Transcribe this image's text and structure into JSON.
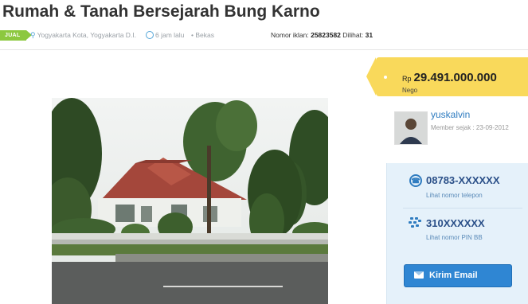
{
  "listing": {
    "title": "Rumah & Tanah Bersejarah Bung Karno",
    "badge": "JUAL",
    "location": "Yogyakarta Kota, Yogyakarta D.I.",
    "posted": "6 jam lalu",
    "condition": "• Bekas",
    "ad_number_label": "Nomor iklan:",
    "ad_number": "25823582",
    "views_label": "Dilihat:",
    "views": "31"
  },
  "price": {
    "currency": "Rp",
    "amount": "29.491.000.000",
    "nego": "Nego"
  },
  "seller": {
    "name": "yuskalvin",
    "member_since": "Member sejak : 23-09-2012"
  },
  "contact": {
    "phone": "08783-XXXXXX",
    "phone_link": "Lihat nomor telepon",
    "bb_pin": "310XXXXXX",
    "bb_link": "Lihat nomor PIN BB",
    "email_button": "Kirim Email"
  },
  "colors": {
    "badge": "#8cc83f",
    "price_tag": "#f9d95b",
    "link": "#2f7cc0",
    "contact_bg": "#e5f1fa",
    "button": "#2f86d3"
  },
  "icons": [
    "location-pin-icon",
    "clock-icon",
    "phone-icon",
    "blackberry-icon",
    "envelope-icon"
  ]
}
